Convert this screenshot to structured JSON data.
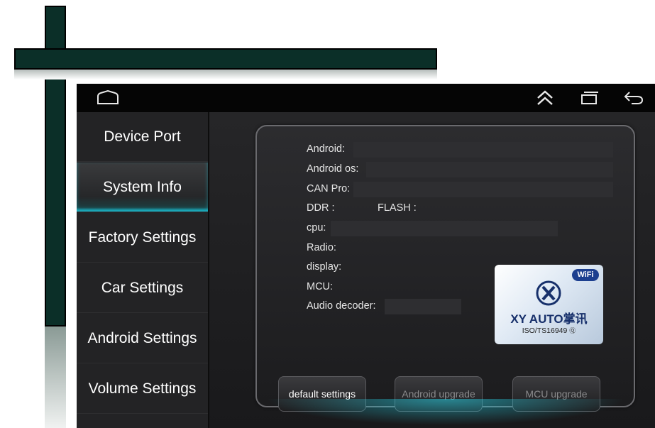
{
  "sidebar": {
    "items": [
      {
        "label": "Device Port",
        "active": false
      },
      {
        "label": "System Info",
        "active": true
      },
      {
        "label": "Factory Settings",
        "active": false
      },
      {
        "label": "Car Settings",
        "active": false
      },
      {
        "label": "Android Settings",
        "active": false
      },
      {
        "label": "Volume Settings",
        "active": false
      }
    ]
  },
  "statusbar": {
    "icons": [
      "home-icon",
      "up-chevron-icon",
      "recent-apps-icon",
      "back-icon"
    ]
  },
  "info": {
    "android_label": "Android:",
    "android_os_label": "Android os:",
    "can_pro_label": "CAN Pro:",
    "ddr_label": "DDR :",
    "flash_label": "FLASH :",
    "cpu_label": "cpu:",
    "radio_label": "Radio:",
    "display_label": "display:",
    "mcu_label": "MCU:",
    "audio_decoder_label": "Audio decoder:"
  },
  "logo": {
    "wifi": "WiFi",
    "brand": "XY AUTO掌讯",
    "cert": "ISO/TS16949"
  },
  "buttons": {
    "default_settings": "default settings",
    "android_upgrade": "Android upgrade",
    "mcu_upgrade": "MCU upgrade"
  },
  "colors": {
    "accent": "#17b5c8",
    "bar": "#0b2f28",
    "screen_bg": "#1a1a1c"
  }
}
